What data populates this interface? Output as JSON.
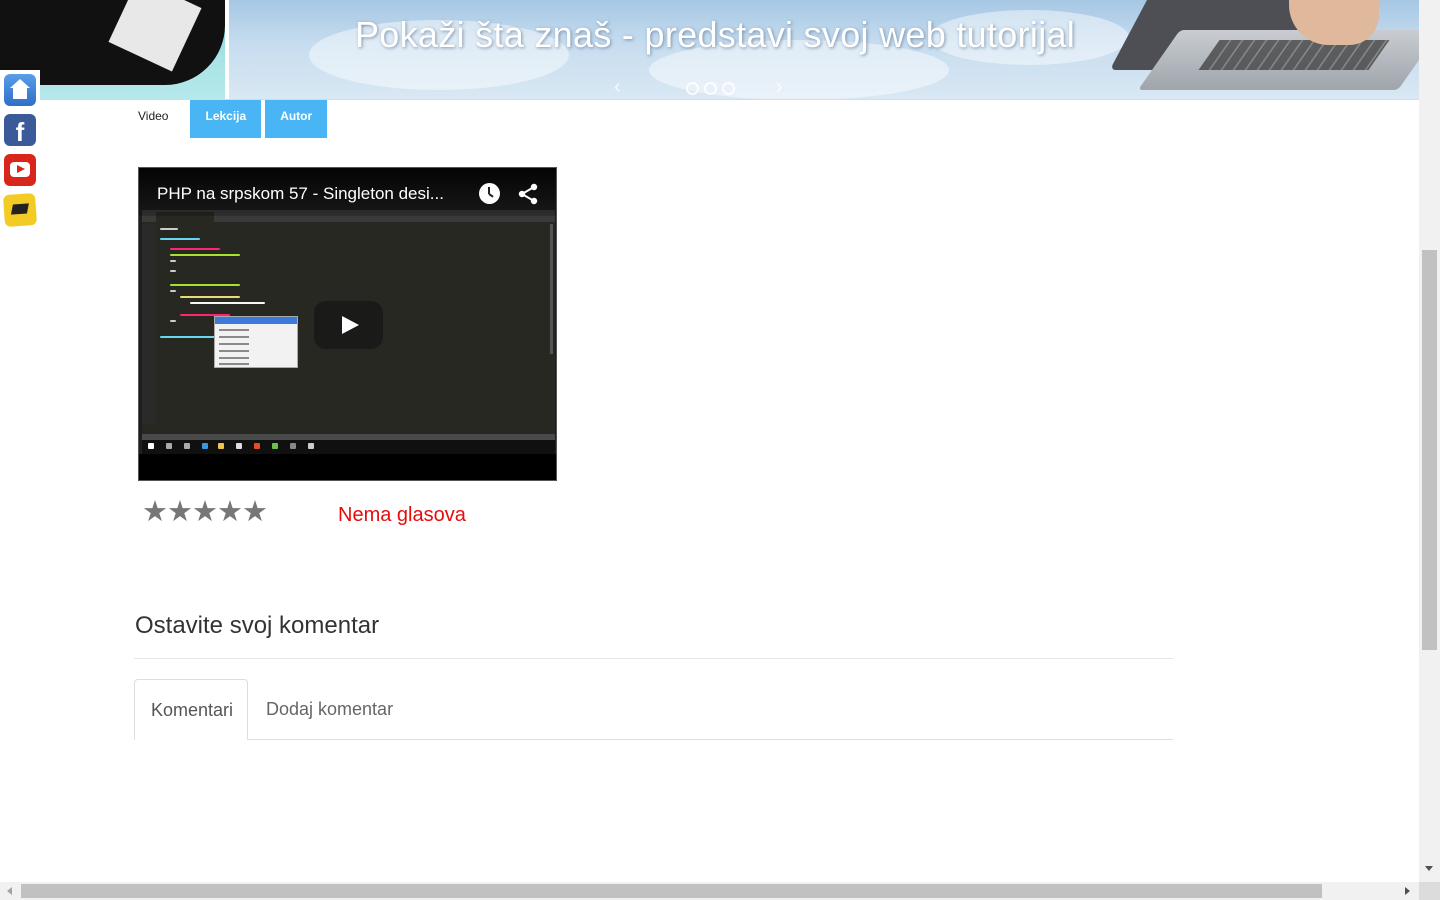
{
  "banner": {
    "title": "Pokaži šta znaš - predstavi svoj web tutorijal",
    "prev_glyph": "‹",
    "next_glyph": "›",
    "slides": 3
  },
  "social": {
    "items": [
      {
        "name": "home",
        "icon": "home-icon"
      },
      {
        "name": "facebook",
        "icon": "facebook-icon",
        "glyph": "f"
      },
      {
        "name": "youtube",
        "icon": "youtube-icon"
      },
      {
        "name": "note",
        "icon": "note-icon"
      }
    ]
  },
  "tabs": {
    "video": "Video",
    "lekcija": "Lekcija",
    "autor": "Autor"
  },
  "video": {
    "title": "PHP na srpskom 57 - Singleton desi...",
    "icons": [
      "clock-icon",
      "share-icon",
      "play-icon"
    ]
  },
  "rating": {
    "star_glyph": "★",
    "stars_total": 5,
    "votes_text": "Nema glasova"
  },
  "comments": {
    "heading": "Ostavite svoj komentar",
    "tabs": [
      "Komentari",
      "Dodaj komentar"
    ],
    "active_tab": "Komentari"
  },
  "colors": {
    "tab_blue": "#4ab5f4",
    "votes_red": "#e60d0d",
    "star_gray": "#777777"
  }
}
